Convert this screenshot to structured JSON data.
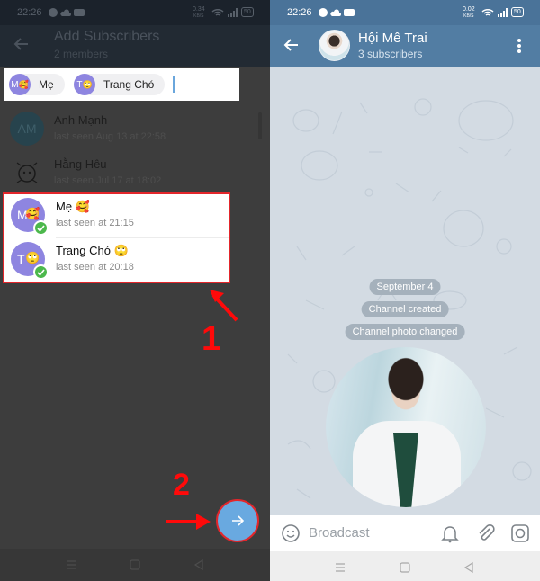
{
  "left_screen": {
    "status_bar": {
      "time": "22:26",
      "net_speed": "0.34",
      "net_unit": "KB/S",
      "battery": "50"
    },
    "app_bar": {
      "title": "Add Subscribers",
      "subtitle": "2 members"
    },
    "selected_chips": [
      {
        "initial": "M",
        "emoji": "🥰",
        "label": "Mẹ"
      },
      {
        "initial": "T",
        "emoji": "🙄",
        "label": "Trang Chó"
      }
    ],
    "contacts": [
      {
        "initials": "AM",
        "name": "Anh Mạnh",
        "last_seen": "last seen Aug 13 at 22:58",
        "selected": false
      },
      {
        "initials": "",
        "name": "Hằng Hêu",
        "last_seen": "last seen Jul 17 at 18:02",
        "selected": false
      },
      {
        "initials": "M",
        "emoji": "🥰",
        "name": "Mẹ 🥰",
        "last_seen": "last seen at 21:15",
        "selected": true
      },
      {
        "initials": "T",
        "emoji": "🙄",
        "name": "Trang Chó 🙄",
        "last_seen": "last seen at 20:18",
        "selected": true
      }
    ],
    "annotations": {
      "step1": "1",
      "step2": "2"
    },
    "fab": {
      "icon": "arrow-right-icon"
    }
  },
  "right_screen": {
    "status_bar": {
      "time": "22:26",
      "net_speed": "0.02",
      "net_unit": "KB/S",
      "battery": "50"
    },
    "app_bar": {
      "title": "Hội Mê Trai",
      "subtitle": "3 subscribers"
    },
    "service_messages": [
      "September 4",
      "Channel created",
      "Channel photo changed"
    ],
    "composer": {
      "placeholder": "Broadcast"
    }
  },
  "colors": {
    "accent": "#527da3",
    "avatar_purple": "#8e85e0",
    "check_green": "#4cb84c",
    "annotation_red": "#e3262b",
    "fab_blue": "#69a9e0"
  }
}
